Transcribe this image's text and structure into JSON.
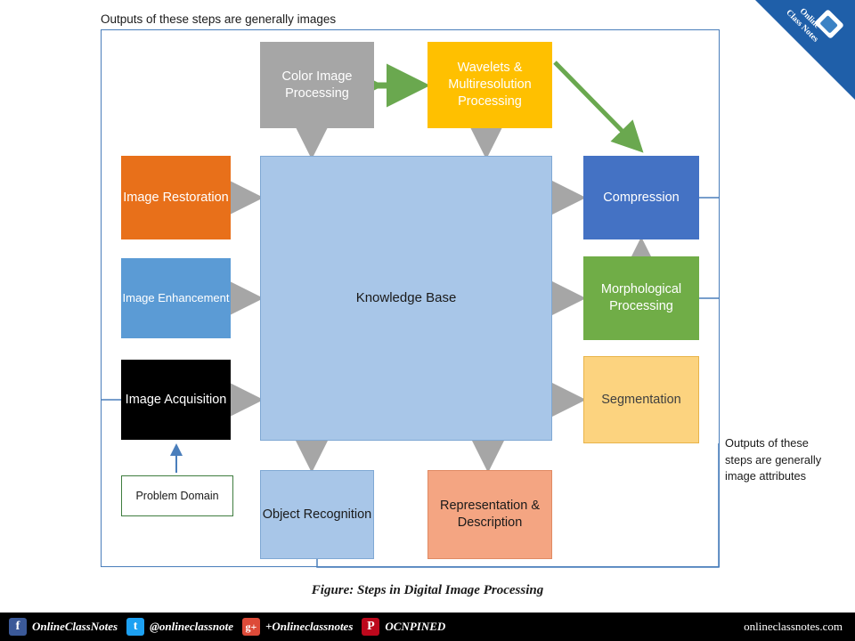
{
  "captions": {
    "top": "Outputs of these steps are generally images",
    "right": "Outputs of these steps are generally image attributes",
    "figure": "Figure: Steps in Digital Image Processing"
  },
  "diagram": {
    "type": "block-flow",
    "boxes": [
      {
        "id": "color_image_processing",
        "label": "Color Image Processing",
        "color": "#a6a6a6",
        "text_color": "#ffffff"
      },
      {
        "id": "wavelets",
        "label": "Wavelets & Multiresolution Processing",
        "color": "#ffc000",
        "text_color": "#ffffff"
      },
      {
        "id": "image_restoration",
        "label": "Image Restoration",
        "color": "#e8701a",
        "text_color": "#ffffff"
      },
      {
        "id": "image_enhancement",
        "label": "Image Enhancement",
        "color": "#5b9bd5",
        "text_color": "#ffffff"
      },
      {
        "id": "image_acquisition",
        "label": "Image Acquisition",
        "color": "#000000",
        "text_color": "#ffffff"
      },
      {
        "id": "knowledge_base",
        "label": "Knowledge Base",
        "color": "#a8c6e8",
        "text_color": "#1a1a1a"
      },
      {
        "id": "compression",
        "label": "Compression",
        "color": "#4472c4",
        "text_color": "#ffffff"
      },
      {
        "id": "morphological_processing",
        "label": "Morphological Processing",
        "color": "#70ad47",
        "text_color": "#ffffff"
      },
      {
        "id": "segmentation",
        "label": "Segmentation",
        "color": "#fcd37f",
        "text_color": "#3f3f3f"
      },
      {
        "id": "object_recognition",
        "label": "Object Recognition",
        "color": "#a8c6e8",
        "text_color": "#1a1a1a"
      },
      {
        "id": "representation_description",
        "label": "Representation & Description",
        "color": "#f4a582",
        "text_color": "#1a1a1a"
      },
      {
        "id": "problem_domain",
        "label": "Problem Domain",
        "color": "#ffffff",
        "text_color": "#1a1a1a"
      }
    ],
    "connections": [
      {
        "from": "color_image_processing",
        "to": "wavelets",
        "style": "double-arrow-green"
      },
      {
        "from": "wavelets",
        "to": "compression",
        "style": "arrow-green"
      },
      {
        "from": "color_image_processing",
        "to": "knowledge_base",
        "style": "double-arrow-gray"
      },
      {
        "from": "wavelets",
        "to": "knowledge_base",
        "style": "double-arrow-gray"
      },
      {
        "from": "image_restoration",
        "to": "knowledge_base",
        "style": "double-arrow-gray"
      },
      {
        "from": "image_enhancement",
        "to": "knowledge_base",
        "style": "double-arrow-gray"
      },
      {
        "from": "image_acquisition",
        "to": "knowledge_base",
        "style": "double-arrow-gray"
      },
      {
        "from": "knowledge_base",
        "to": "compression",
        "style": "double-arrow-gray"
      },
      {
        "from": "knowledge_base",
        "to": "morphological_processing",
        "style": "double-arrow-gray"
      },
      {
        "from": "knowledge_base",
        "to": "segmentation",
        "style": "double-arrow-gray"
      },
      {
        "from": "knowledge_base",
        "to": "object_recognition",
        "style": "double-arrow-gray"
      },
      {
        "from": "knowledge_base",
        "to": "representation_description",
        "style": "double-arrow-gray"
      },
      {
        "from": "morphological_processing",
        "to": "compression",
        "style": "double-arrow-gray"
      },
      {
        "from": "problem_domain",
        "to": "image_acquisition",
        "style": "arrow-blue"
      }
    ]
  },
  "ribbon": {
    "line1": "Online",
    "line2": "Class Notes",
    "icon": "notebook-icon",
    "color": "#1f5fa9"
  },
  "footer": {
    "items": [
      {
        "icon": "facebook-icon",
        "glyph": "f",
        "label": "OnlineClassNotes"
      },
      {
        "icon": "twitter-icon",
        "glyph": "t",
        "label": "@onlineclassnote"
      },
      {
        "icon": "googleplus-icon",
        "glyph": "g+",
        "label": "+Onlineclassnotes"
      },
      {
        "icon": "pinterest-icon",
        "glyph": "P",
        "label": "OCNPINED"
      }
    ],
    "site": "onlineclassnotes.com"
  }
}
